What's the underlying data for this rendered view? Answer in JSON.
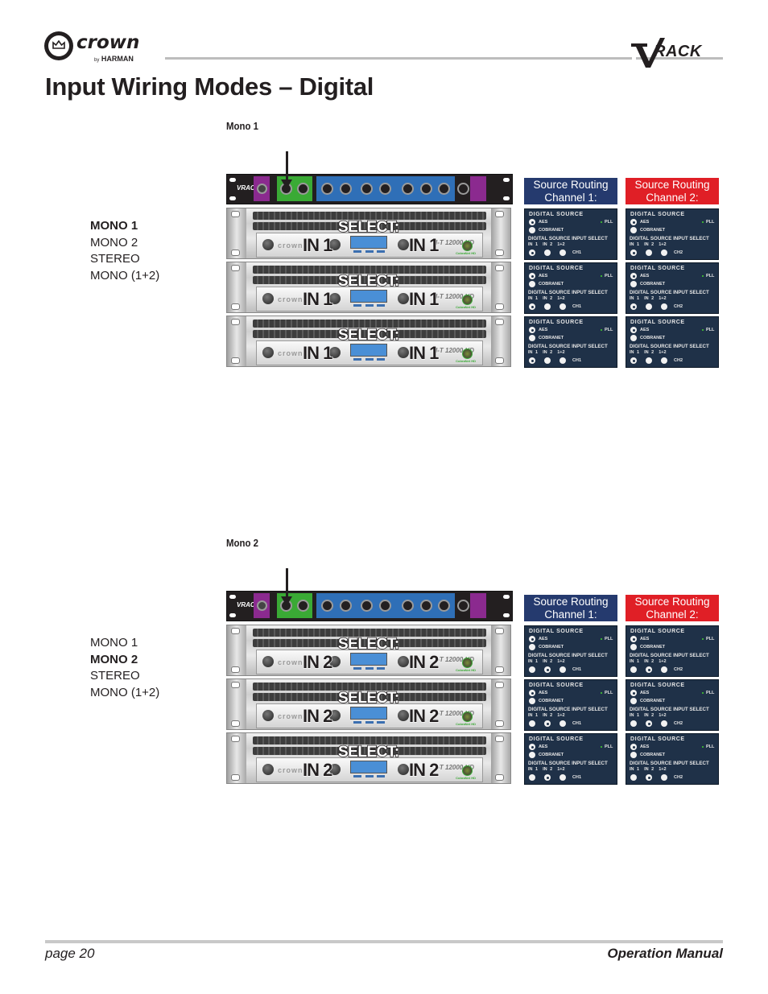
{
  "header": {
    "brand_logo": "crown",
    "brand_sub_by": "by",
    "brand_sub_company": "HARMAN",
    "product_logo": "RACK",
    "page_title": "Input Wiring Modes – Digital"
  },
  "colors": {
    "text": "#231f20",
    "channel1_header": "#253a6e",
    "channel2_header": "#e01f26",
    "panel_bg": "#1f3148",
    "rule_gray": "#bdbdbd",
    "pll_led": "#3aaa35",
    "green_module": "#3aaa35",
    "blue_module": "#2f6fb7",
    "purple_module": "#8b2a8f"
  },
  "modes": [
    "MONO 1",
    "MONO 2",
    "STEREO",
    "MONO (1+2)"
  ],
  "sections": [
    {
      "label": "Mono 1",
      "selected_mode_index": 0,
      "amp_overlay_select": "SELECT:",
      "amp_overlay_input": "IN 1",
      "amp_brand": "crown",
      "amp_model": "I-T 12000 HD",
      "amp_badge": "CobraNet HD",
      "source_routing": [
        {
          "title_line1": "Source Routing",
          "title_line2": "Channel 1:"
        },
        {
          "title_line1": "Source Routing",
          "title_line2": "Channel 2:"
        }
      ],
      "selected_input": "IN 1"
    },
    {
      "label": "Mono 2",
      "selected_mode_index": 1,
      "amp_overlay_select": "SELECT:",
      "amp_overlay_input": "IN 2",
      "amp_brand": "crown",
      "amp_model": "I-T 12000 HD",
      "amp_badge": "CobraNet HD",
      "source_routing": [
        {
          "title_line1": "Source Routing",
          "title_line2": "Channel 1:"
        },
        {
          "title_line1": "Source Routing",
          "title_line2": "Channel 2:"
        }
      ],
      "selected_input": "IN 2"
    }
  ],
  "digital_source_panel": {
    "title": "DIGITAL SOURCE",
    "opt_aes": "AES",
    "opt_cobranet": "COBRANET",
    "pll": "PLL",
    "input_select_title": "DIGITAL SOURCE INPUT SELECT",
    "in1": "IN 1",
    "in2": "IN 2",
    "in12": "1+2",
    "ch1": "CH1",
    "ch2": "CH2",
    "selected_source": "AES"
  },
  "footer": {
    "page": "page 20",
    "manual": "Operation Manual"
  }
}
